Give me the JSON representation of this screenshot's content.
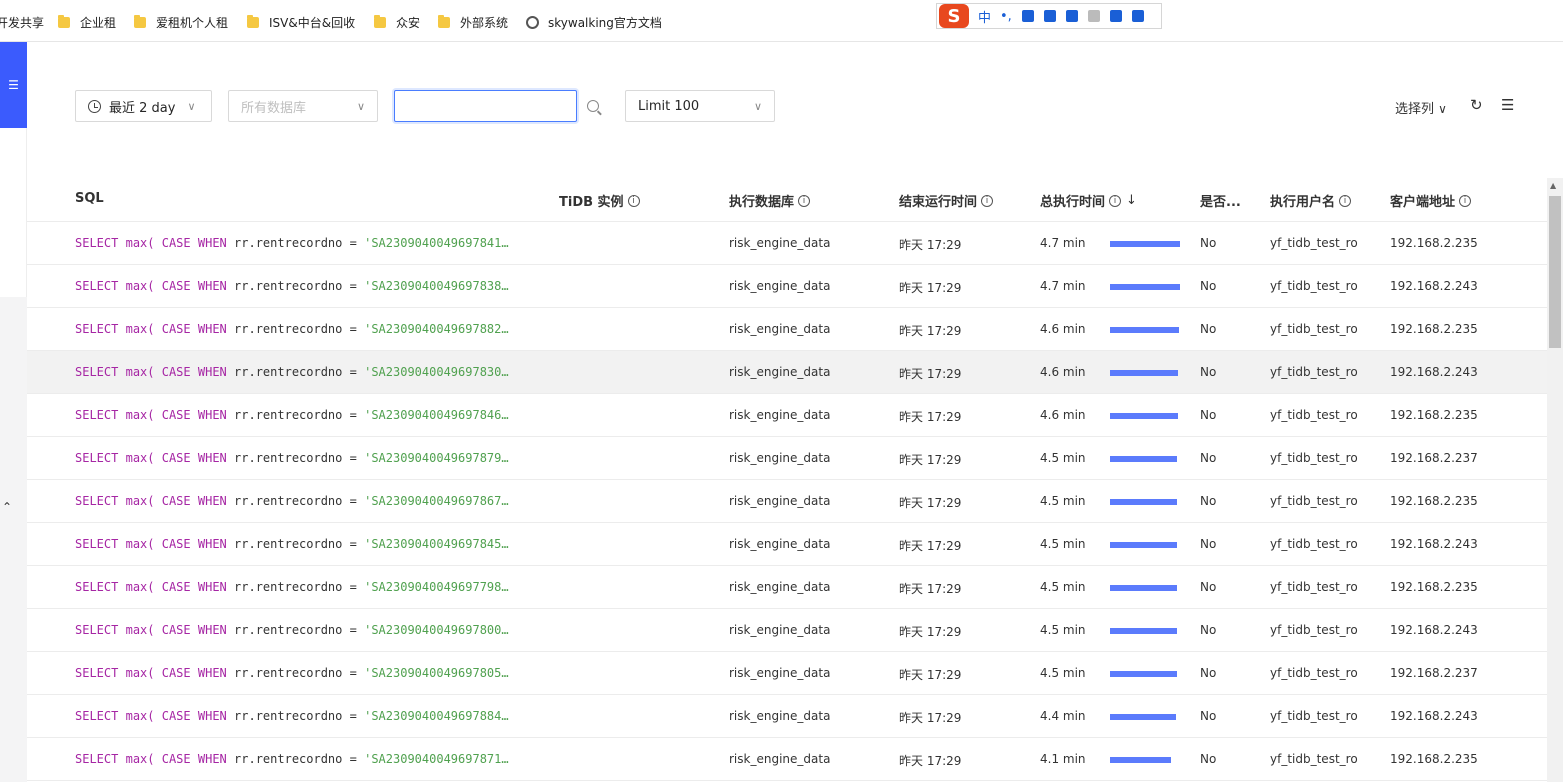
{
  "bookmarks": [
    {
      "label": "开发共享",
      "icon": "none"
    },
    {
      "label": "企业租",
      "icon": "folder-icon"
    },
    {
      "label": "爱租机个人租",
      "icon": "folder-icon"
    },
    {
      "label": "ISV&中台&回收",
      "icon": "folder-icon"
    },
    {
      "label": "众安",
      "icon": "folder-icon"
    },
    {
      "label": "外部系统",
      "icon": "folder-icon"
    },
    {
      "label": "skywalking官方文档",
      "icon": "globe-icon"
    }
  ],
  "ime": {
    "logo": "S",
    "mode": "中",
    "punct": "•,"
  },
  "toolbar": {
    "time_range": "最近 2 day",
    "database_placeholder": "所有数据库",
    "search_value": "",
    "limit": "Limit 100",
    "select_columns": "选择列"
  },
  "table": {
    "columns": {
      "sql": "SQL",
      "instance": "TiDB 实例",
      "db": "执行数据库",
      "end_time": "结束运行时间",
      "total_time": "总执行时间",
      "is_x": "是否...",
      "user": "执行用户名",
      "client": "客户端地址"
    },
    "rows": [
      {
        "sql_kw1": "SELECT",
        "sql_fn": "max(",
        "sql_kw2": "CASE",
        "sql_kw3": "WHEN",
        "sql_col": "rr.rentrecordno",
        "sql_eq": "=",
        "sql_str": "'SA2309040049697841…",
        "db": "risk_engine_data",
        "end": "昨天 17:29",
        "dur": "4.7 min",
        "ratio": 1.0,
        "flag": "No",
        "user": "yf_tidb_test_ro",
        "client": "192.168.2.235"
      },
      {
        "sql_kw1": "SELECT",
        "sql_fn": "max(",
        "sql_kw2": "CASE",
        "sql_kw3": "WHEN",
        "sql_col": "rr.rentrecordno",
        "sql_eq": "=",
        "sql_str": "'SA2309040049697838…",
        "db": "risk_engine_data",
        "end": "昨天 17:29",
        "dur": "4.7 min",
        "ratio": 1.0,
        "flag": "No",
        "user": "yf_tidb_test_ro",
        "client": "192.168.2.243"
      },
      {
        "sql_kw1": "SELECT",
        "sql_fn": "max(",
        "sql_kw2": "CASE",
        "sql_kw3": "WHEN",
        "sql_col": "rr.rentrecordno",
        "sql_eq": "=",
        "sql_str": "'SA2309040049697882…",
        "db": "risk_engine_data",
        "end": "昨天 17:29",
        "dur": "4.6 min",
        "ratio": 0.98,
        "flag": "No",
        "user": "yf_tidb_test_ro",
        "client": "192.168.2.235"
      },
      {
        "sql_kw1": "SELECT",
        "sql_fn": "max(",
        "sql_kw2": "CASE",
        "sql_kw3": "WHEN",
        "sql_col": "rr.rentrecordno",
        "sql_eq": "=",
        "sql_str": "'SA2309040049697830…",
        "db": "risk_engine_data",
        "end": "昨天 17:29",
        "dur": "4.6 min",
        "ratio": 0.97,
        "flag": "No",
        "user": "yf_tidb_test_ro",
        "client": "192.168.2.243"
      },
      {
        "sql_kw1": "SELECT",
        "sql_fn": "max(",
        "sql_kw2": "CASE",
        "sql_kw3": "WHEN",
        "sql_col": "rr.rentrecordno",
        "sql_eq": "=",
        "sql_str": "'SA2309040049697846…",
        "db": "risk_engine_data",
        "end": "昨天 17:29",
        "dur": "4.6 min",
        "ratio": 0.97,
        "flag": "No",
        "user": "yf_tidb_test_ro",
        "client": "192.168.2.235"
      },
      {
        "sql_kw1": "SELECT",
        "sql_fn": "max(",
        "sql_kw2": "CASE",
        "sql_kw3": "WHEN",
        "sql_col": "rr.rentrecordno",
        "sql_eq": "=",
        "sql_str": "'SA2309040049697879…",
        "db": "risk_engine_data",
        "end": "昨天 17:29",
        "dur": "4.5 min",
        "ratio": 0.96,
        "flag": "No",
        "user": "yf_tidb_test_ro",
        "client": "192.168.2.237"
      },
      {
        "sql_kw1": "SELECT",
        "sql_fn": "max(",
        "sql_kw2": "CASE",
        "sql_kw3": "WHEN",
        "sql_col": "rr.rentrecordno",
        "sql_eq": "=",
        "sql_str": "'SA2309040049697867…",
        "db": "risk_engine_data",
        "end": "昨天 17:29",
        "dur": "4.5 min",
        "ratio": 0.96,
        "flag": "No",
        "user": "yf_tidb_test_ro",
        "client": "192.168.2.235"
      },
      {
        "sql_kw1": "SELECT",
        "sql_fn": "max(",
        "sql_kw2": "CASE",
        "sql_kw3": "WHEN",
        "sql_col": "rr.rentrecordno",
        "sql_eq": "=",
        "sql_str": "'SA2309040049697845…",
        "db": "risk_engine_data",
        "end": "昨天 17:29",
        "dur": "4.5 min",
        "ratio": 0.96,
        "flag": "No",
        "user": "yf_tidb_test_ro",
        "client": "192.168.2.243"
      },
      {
        "sql_kw1": "SELECT",
        "sql_fn": "max(",
        "sql_kw2": "CASE",
        "sql_kw3": "WHEN",
        "sql_col": "rr.rentrecordno",
        "sql_eq": "=",
        "sql_str": "'SA2309040049697798…",
        "db": "risk_engine_data",
        "end": "昨天 17:29",
        "dur": "4.5 min",
        "ratio": 0.95,
        "flag": "No",
        "user": "yf_tidb_test_ro",
        "client": "192.168.2.235"
      },
      {
        "sql_kw1": "SELECT",
        "sql_fn": "max(",
        "sql_kw2": "CASE",
        "sql_kw3": "WHEN",
        "sql_col": "rr.rentrecordno",
        "sql_eq": "=",
        "sql_str": "'SA2309040049697800…",
        "db": "risk_engine_data",
        "end": "昨天 17:29",
        "dur": "4.5 min",
        "ratio": 0.95,
        "flag": "No",
        "user": "yf_tidb_test_ro",
        "client": "192.168.2.243"
      },
      {
        "sql_kw1": "SELECT",
        "sql_fn": "max(",
        "sql_kw2": "CASE",
        "sql_kw3": "WHEN",
        "sql_col": "rr.rentrecordno",
        "sql_eq": "=",
        "sql_str": "'SA2309040049697805…",
        "db": "risk_engine_data",
        "end": "昨天 17:29",
        "dur": "4.5 min",
        "ratio": 0.95,
        "flag": "No",
        "user": "yf_tidb_test_ro",
        "client": "192.168.2.237"
      },
      {
        "sql_kw1": "SELECT",
        "sql_fn": "max(",
        "sql_kw2": "CASE",
        "sql_kw3": "WHEN",
        "sql_col": "rr.rentrecordno",
        "sql_eq": "=",
        "sql_str": "'SA2309040049697884…",
        "db": "risk_engine_data",
        "end": "昨天 17:29",
        "dur": "4.4 min",
        "ratio": 0.94,
        "flag": "No",
        "user": "yf_tidb_test_ro",
        "client": "192.168.2.243"
      },
      {
        "sql_kw1": "SELECT",
        "sql_fn": "max(",
        "sql_kw2": "CASE",
        "sql_kw3": "WHEN",
        "sql_col": "rr.rentrecordno",
        "sql_eq": "=",
        "sql_str": "'SA2309040049697871…",
        "db": "risk_engine_data",
        "end": "昨天 17:29",
        "dur": "4.1 min",
        "ratio": 0.87,
        "flag": "No",
        "user": "yf_tidb_test_ro",
        "client": "192.168.2.235"
      }
    ]
  }
}
